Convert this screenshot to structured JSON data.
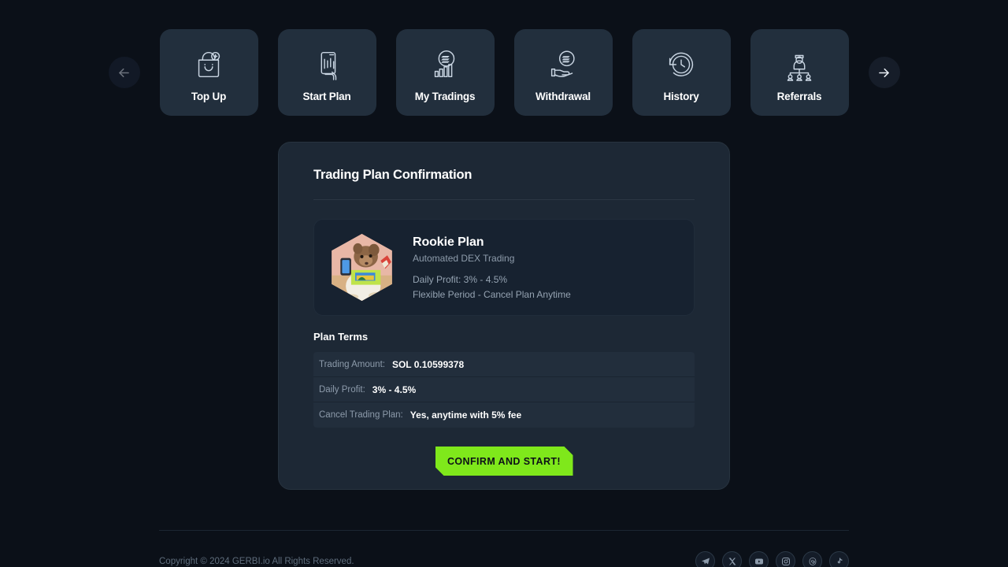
{
  "nav": {
    "prev_arrow": "left-arrow",
    "next_arrow": "right-arrow",
    "items": [
      {
        "label": "Top Up",
        "icon": "shopping-bag-plus-icon"
      },
      {
        "label": "Start Plan",
        "icon": "hand-holding-phone-chart-icon"
      },
      {
        "label": "My Tradings",
        "icon": "solana-bar-chart-icon"
      },
      {
        "label": "Withdrawal",
        "icon": "hand-holding-solana-icon"
      },
      {
        "label": "History",
        "icon": "clock-rotate-icon"
      },
      {
        "label": "Referrals",
        "icon": "referral-network-icon"
      }
    ]
  },
  "card": {
    "title": "Trading Plan Confirmation",
    "plan": {
      "name": "Rookie Plan",
      "subtitle": "Automated DEX Trading",
      "daily_profit": "Daily Profit: 3% - 4.5%",
      "period": "Flexible Period - Cancel Plan Anytime",
      "avatar": "gerbil-avatar-image"
    },
    "terms_title": "Plan Terms",
    "terms": [
      {
        "label": "Trading Amount:",
        "value": "SOL 0.10599378"
      },
      {
        "label": "Daily Profit:",
        "value": "3% - 4.5%"
      },
      {
        "label": "Cancel Trading Plan:",
        "value": "Yes, anytime with 5% fee"
      }
    ],
    "confirm_label": "CONFIRM AND START!"
  },
  "footer": {
    "copyright": "Copyright © 2024 GERBI.io All Rights Reserved.",
    "socials": [
      {
        "name": "telegram-icon"
      },
      {
        "name": "x-twitter-icon"
      },
      {
        "name": "youtube-icon"
      },
      {
        "name": "instagram-icon"
      },
      {
        "name": "threads-icon"
      },
      {
        "name": "tiktok-icon"
      }
    ]
  },
  "colors": {
    "background": "#0b1018",
    "card": "#1d2835",
    "nav_card": "#222f3d",
    "accent_green": "#7fe81b",
    "row": "#222e3c"
  }
}
